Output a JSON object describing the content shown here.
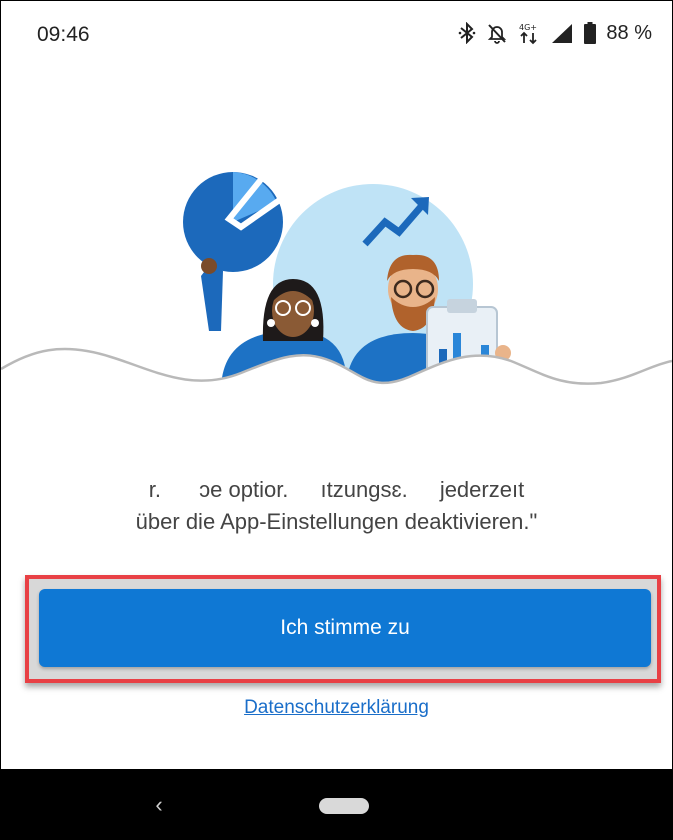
{
  "status_bar": {
    "time": "09:46",
    "battery": "88 %",
    "network_label": "4G+",
    "icons": [
      "bluetooth-icon",
      "notifications-off-icon",
      "network-4g-icon",
      "signal-icon",
      "battery-icon"
    ]
  },
  "illustration": {
    "name": "people-with-charts-illustration"
  },
  "consent": {
    "line1_parts": [
      "r.",
      "ɔe optior.",
      "ıtzungsɛ.",
      "jederzeıt"
    ],
    "line2": "über die App-Einstellungen deaktivieren.\""
  },
  "button": {
    "label": "Ich stimme zu"
  },
  "privacy_link": {
    "label": "Datenschutzerklärung"
  },
  "colors": {
    "primary": "#0f78d4",
    "highlight": "#e84045",
    "link": "#1a6ec9"
  },
  "nav": {
    "back_icon": "back-chevron-icon",
    "home_icon": "home-pill-icon"
  }
}
